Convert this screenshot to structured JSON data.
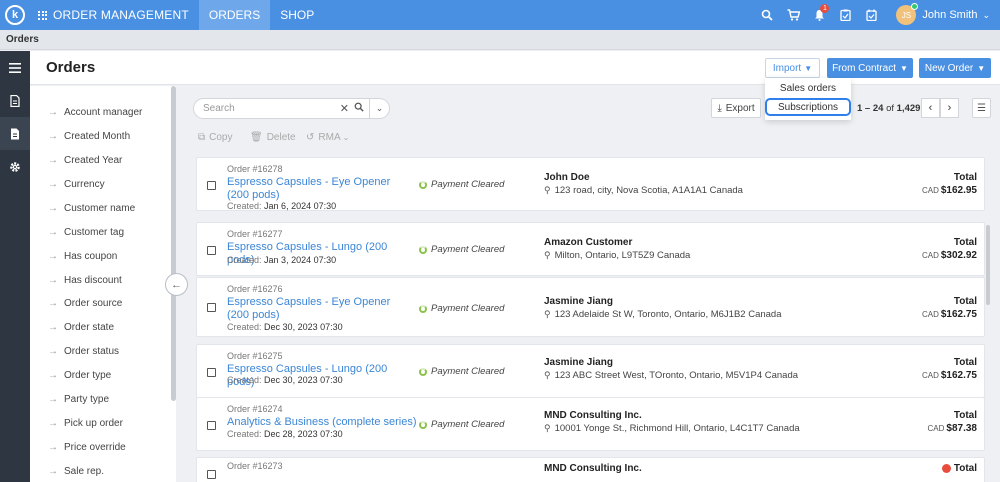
{
  "topbar": {
    "app_name": "ORDER MANAGEMENT",
    "tabs": [
      {
        "label": "ORDERS",
        "active": true
      },
      {
        "label": "SHOP",
        "active": false
      }
    ],
    "notification_count": "1",
    "user": {
      "initials": "JS",
      "name": "John Smith"
    },
    "accent_color": "#4a90e2"
  },
  "breadcrumb": "Orders",
  "header": {
    "title": "Orders",
    "import_label": "Import",
    "from_contract_label": "From Contract",
    "new_order_label": "New Order"
  },
  "import_menu": {
    "items": [
      "Sales orders",
      "Subscriptions"
    ],
    "focused": "Subscriptions"
  },
  "filters": [
    "Account manager",
    "Created Month",
    "Created Year",
    "Currency",
    "Customer name",
    "Customer tag",
    "Has coupon",
    "Has discount",
    "Order source",
    "Order state",
    "Order status",
    "Order type",
    "Party type",
    "Pick up order",
    "Price override",
    "Sale rep."
  ],
  "toolbar": {
    "search_placeholder": "Search",
    "copy_label": "Copy",
    "delete_label": "Delete",
    "rma_label": "RMA",
    "export_label": "Export",
    "pager_range": "1 – 24",
    "pager_of": "of",
    "pager_total": "1,429"
  },
  "orders": [
    {
      "number": "Order #16278",
      "title": "Espresso Capsules - Eye Opener (200 pods)",
      "created_label": "Created:",
      "created": "Jan 6, 2024 07:30",
      "status": "Payment Cleared",
      "customer": "John Doe",
      "address": "123 road, city, Nova Scotia, A1A1A1 Canada",
      "total_label": "Total",
      "currency": "CAD",
      "total": "$162.95"
    },
    {
      "number": "Order #16277",
      "title": "Espresso Capsules - Lungo (200 pods)",
      "created_label": "Created:",
      "created": "Jan 3, 2024 07:30",
      "status": "Payment Cleared",
      "customer": "Amazon Customer",
      "address": "Milton, Ontario, L9T5Z9 Canada",
      "total_label": "Total",
      "currency": "CAD",
      "total": "$302.92"
    },
    {
      "number": "Order #16276",
      "title": "Espresso Capsules - Eye Opener (200 pods)",
      "created_label": "Created:",
      "created": "Dec 30, 2023 07:30",
      "status": "Payment Cleared",
      "customer": "Jasmine Jiang",
      "address": "123 Adelaide St W, Toronto, Ontario, M6J1B2 Canada",
      "total_label": "Total",
      "currency": "CAD",
      "total": "$162.75"
    },
    {
      "number": "Order #16275",
      "title": "Espresso Capsules - Lungo (200 pods)",
      "created_label": "Created:",
      "created": "Dec 30, 2023 07:30",
      "status": "Payment Cleared",
      "customer": "Jasmine Jiang",
      "address": "123 ABC Street West, TOronto, Ontario, M5V1P4 Canada",
      "total_label": "Total",
      "currency": "CAD",
      "total": "$162.75"
    },
    {
      "number": "Order #16274",
      "title": "Analytics & Business (complete series)",
      "created_label": "Created:",
      "created": "Dec 28, 2023 07:30",
      "status": "Payment Cleared",
      "customer": "MND Consulting Inc.",
      "address": "10001 Yonge St., Richmond Hill, Ontario, L4C1T7 Canada",
      "total_label": "Total",
      "currency": "CAD",
      "total": "$87.38"
    },
    {
      "number": "Order #16273",
      "title": "",
      "created_label": "",
      "created": "",
      "status": "",
      "customer": "MND Consulting Inc.",
      "address": "",
      "total_label": "Total",
      "currency": "",
      "total": ""
    }
  ]
}
